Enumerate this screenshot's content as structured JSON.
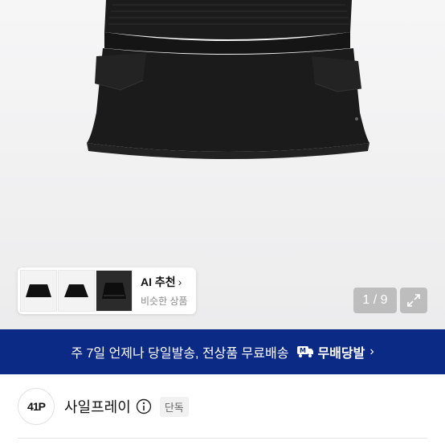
{
  "ai_card": {
    "title": "AI 추천",
    "chevron": "›",
    "subtitle": "비슷한 상품",
    "thumbnails": [
      "thumb-mini-skirt-1",
      "thumb-mini-skirt-2",
      "thumb-mini-skirt-3"
    ]
  },
  "gallery": {
    "counter": "1 / 9",
    "expand_icon": "expand-icon"
  },
  "banner": {
    "text": "주 7일 언제나 당일발송, 전상품 무료배송",
    "icon": "free-delivery-icon",
    "brand": "무배당발",
    "chevron": "›",
    "colors": {
      "background": "#0b2a86",
      "text": "#ffffff"
    }
  },
  "brand": {
    "logo_text": "41P",
    "name": "사일프레이",
    "info_icon": "info-icon",
    "badge": "단독"
  }
}
